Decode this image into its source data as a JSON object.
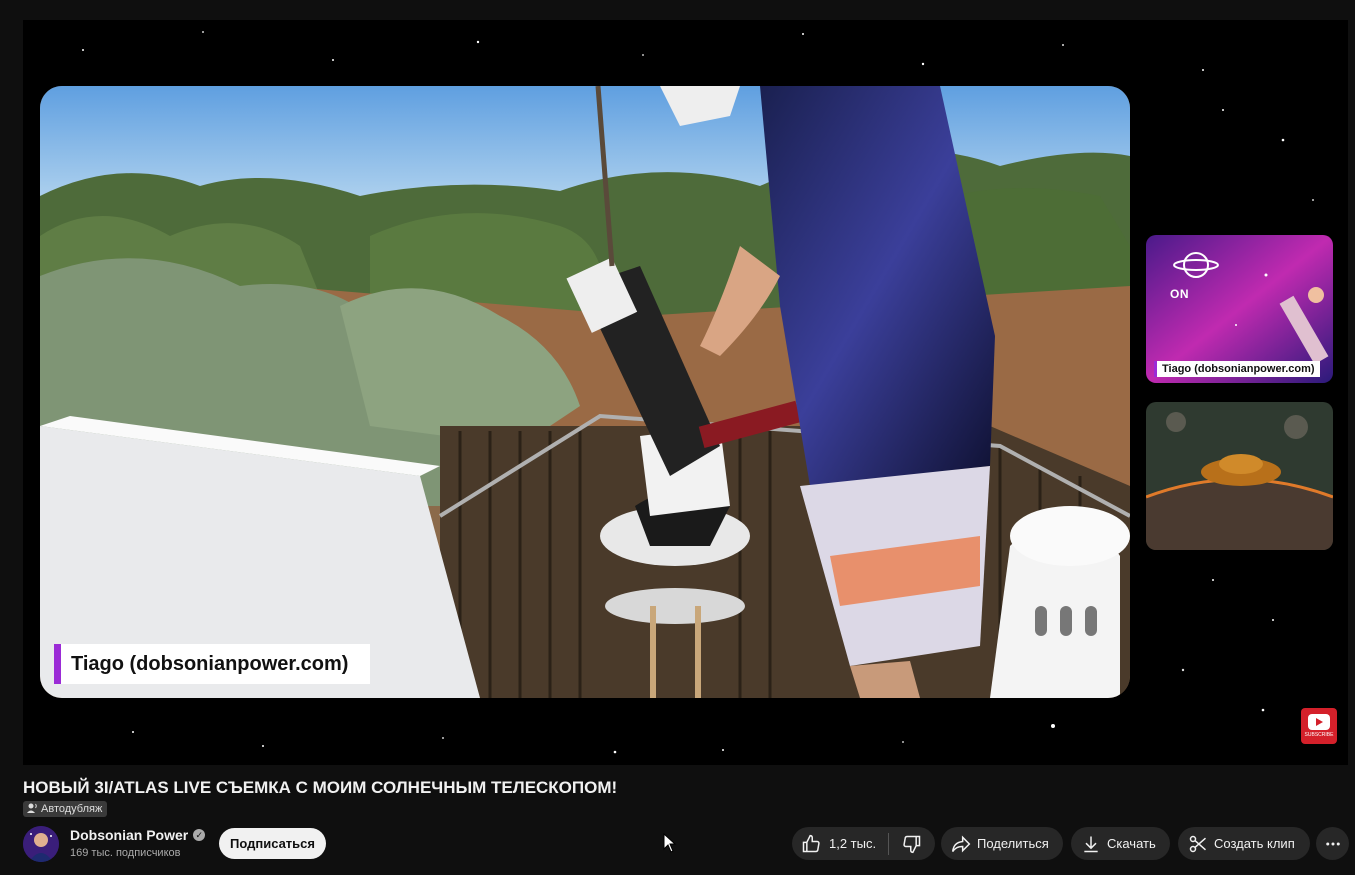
{
  "video": {
    "title": "НОВЫЙ 3I/ATLAS LIVE СЪЕМКА С МОИМ СОЛНЕЧНЫМ ТЕЛЕСКОПОМ!",
    "dub_badge": "Автодубляж",
    "overlay_name_tag": "Tiago (dobsonianpower.com)",
    "side_cam_tag": "Tiago (dobsonianpower.com)",
    "side_cam_onair": "ON",
    "subscribe_logo_text": "SUBSCRIBE"
  },
  "channel": {
    "name": "Dobsonian Power",
    "subscribers": "169 тыс. подписчиков",
    "subscribe_label": "Подписаться"
  },
  "actions": {
    "likes": "1,2 тыс.",
    "share": "Поделиться",
    "download": "Скачать",
    "clip": "Создать клип"
  },
  "icons": {
    "like": "thumbs-up-icon",
    "dislike": "thumbs-down-icon",
    "share": "share-arrow-icon",
    "download": "download-icon",
    "clip": "scissors-icon",
    "more": "more-horizontal-icon",
    "verified": "verified-check-icon",
    "dub": "voice-dub-icon"
  },
  "colors": {
    "background": "#0f0f0f",
    "pill": "#272727",
    "subscribe_button": "#f1f1f1",
    "accent_purple": "#9b2bd6",
    "youtube_red": "#d4202a"
  }
}
